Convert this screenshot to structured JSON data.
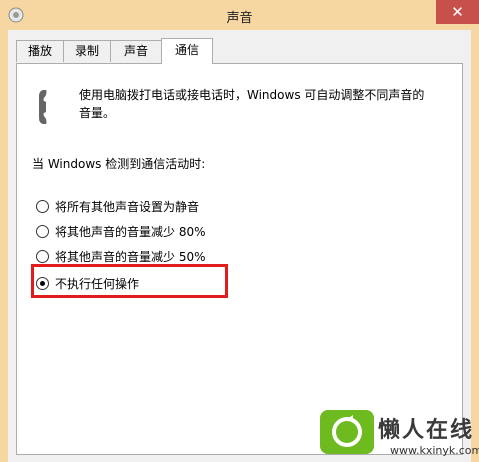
{
  "window": {
    "title": "声音",
    "close_glyph": "✕"
  },
  "tabs": [
    {
      "label": "播放",
      "active": false
    },
    {
      "label": "录制",
      "active": false
    },
    {
      "label": "声音",
      "active": false
    },
    {
      "label": "通信",
      "active": true
    }
  ],
  "panel": {
    "description": "使用电脑拨打电话或接电话时，Windows 可自动调整不同声音的音量。",
    "group_label": "当 Windows 检测到通信活动时:",
    "options": [
      {
        "label": "将所有其他声音设置为静音",
        "checked": false
      },
      {
        "label": "将其他声音的音量减少 80%",
        "checked": false
      },
      {
        "label": "将其他声音的音量减少 50%",
        "checked": false
      },
      {
        "label": "不执行任何操作",
        "checked": true
      }
    ]
  },
  "watermark": {
    "text": "懒人在线",
    "url": "www.kxinyk.com"
  },
  "colors": {
    "titlebar": "#f6d7a1",
    "close": "#c7504a",
    "highlight": "#e01c1c",
    "watermark_logo": "#6dbb1f"
  }
}
